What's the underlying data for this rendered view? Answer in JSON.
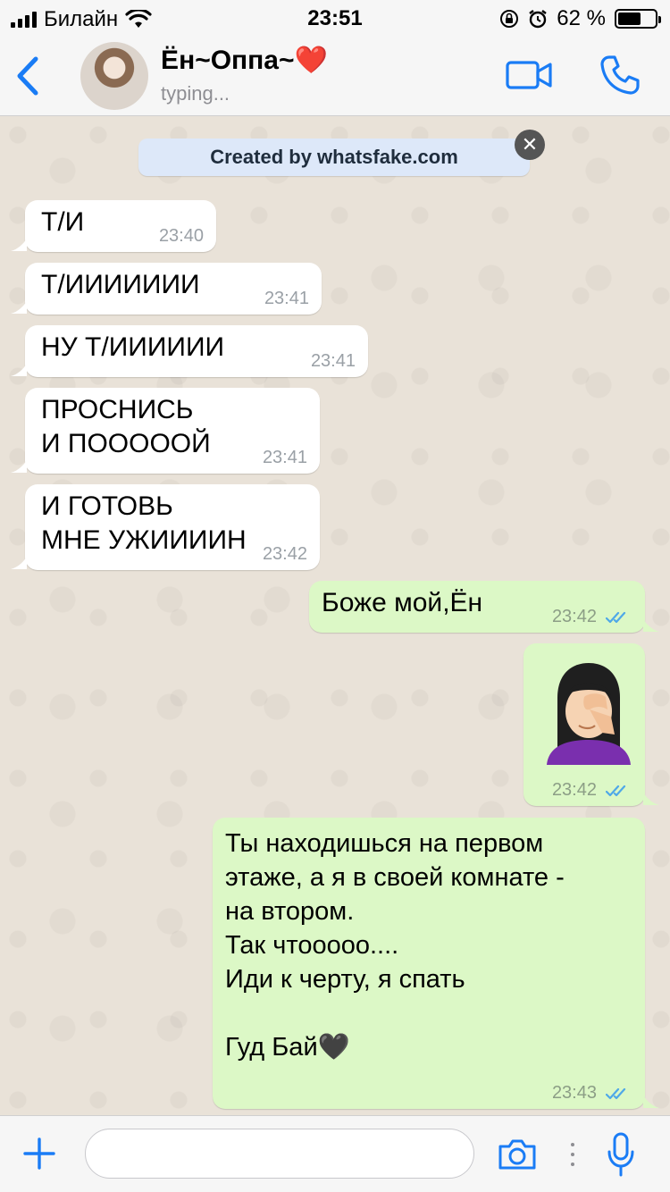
{
  "status_bar": {
    "carrier": "Билайн",
    "time": "23:51",
    "battery": "62 %",
    "battery_level": 0.62
  },
  "header": {
    "contact_name": "Ён~Оппа~❤️",
    "status": "typing..."
  },
  "notice": {
    "text": "Created by whatsfake.com",
    "close": "✕"
  },
  "messages": [
    {
      "dir": "in",
      "text": "Т/И",
      "time": "23:40"
    },
    {
      "dir": "in",
      "text": "Т/ИИИИИИИ",
      "time": "23:41"
    },
    {
      "dir": "in",
      "text": "НУ Т/ИИИИИИ",
      "time": "23:41"
    },
    {
      "dir": "in",
      "text": "ПРОСНИСЬ\nИ ПООООOЙ",
      "time": "23:41"
    },
    {
      "dir": "in",
      "text": "И ГОТОВЬ\nМНЕ УЖИИИИН",
      "time": "23:42"
    },
    {
      "dir": "out",
      "text": "Боже мой,Ён",
      "time": "23:42",
      "read": true
    },
    {
      "dir": "out",
      "emoji": "woman-facepalming",
      "time": "23:42",
      "read": true
    },
    {
      "dir": "out",
      "text": "Ты находишься на первом\nэтаже, а я в своей комнате -\nна втором.\nТак чтооооо....\nИди к черту, я спать\n\nГуд Бай🖤",
      "time": "23:43",
      "read": true
    }
  ],
  "input": {
    "placeholder": ""
  },
  "colors": {
    "accent": "#1a7cf5",
    "incoming_bubble": "#ffffff",
    "outgoing_bubble": "#dcf8c6",
    "read_ticks": "#4fa8e8",
    "chat_background": "#e9e2d8"
  }
}
